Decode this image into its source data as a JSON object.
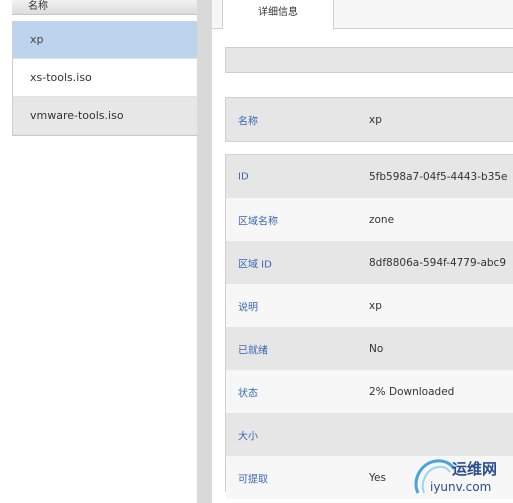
{
  "list": {
    "header": "名称",
    "items": [
      {
        "label": "xp",
        "selected": true
      },
      {
        "label": "xs-tools.iso",
        "selected": false
      },
      {
        "label": "vmware-tools.iso",
        "selected": false
      }
    ]
  },
  "tabs": [
    {
      "label": "详细信息"
    }
  ],
  "details": {
    "name_row": {
      "key": "名称",
      "value": "xp"
    },
    "rows": [
      {
        "key": "ID",
        "value": "5fb598a7-04f5-4443-b35e"
      },
      {
        "key": "区域名称",
        "value": "zone"
      },
      {
        "key": "区域 ID",
        "value": "8df8806a-594f-4779-abc9"
      },
      {
        "key": "说明",
        "value": "xp"
      },
      {
        "key": "已就绪",
        "value": "No"
      },
      {
        "key": "状态",
        "value": "2% Downloaded"
      },
      {
        "key": "大小",
        "value": ""
      },
      {
        "key": "可提取",
        "value": "Yes"
      }
    ]
  },
  "watermark": {
    "text_cn": "运维网",
    "text_en": "iyunv.com"
  },
  "colors": {
    "selected_row": "#bed3ee",
    "key_text": "#3a67b5",
    "alt_row": "#e6e6e6"
  }
}
